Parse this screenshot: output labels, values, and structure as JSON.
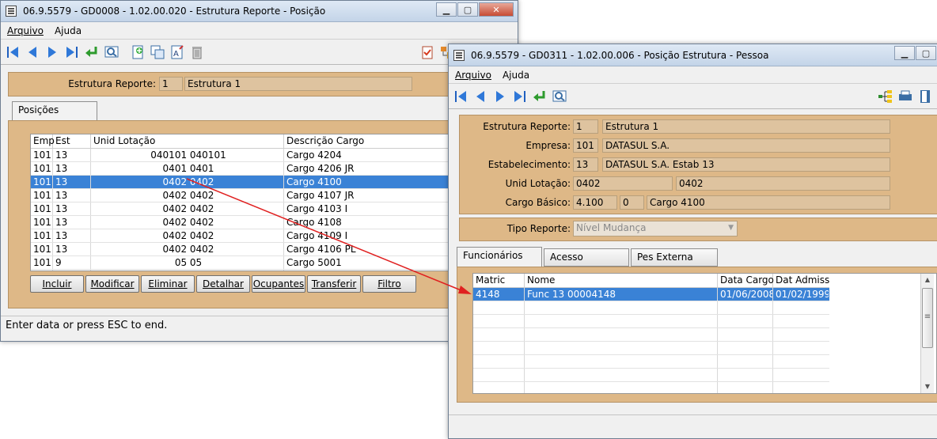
{
  "win1": {
    "title": "06.9.5579 - GD0008 - 1.02.00.020 - Estrutura Reporte - Posição",
    "menu": [
      "Arquivo",
      "Ajuda"
    ],
    "estrutura_label": "Estrutura Reporte:",
    "estrutura_code": "1",
    "estrutura_desc": "Estrutura 1",
    "tab": "Posições",
    "columns": [
      "Emp",
      "Est",
      "Unid Lotação",
      "Descrição Cargo"
    ],
    "rows": [
      [
        "101",
        "13",
        "040101 040101",
        "Cargo 4204"
      ],
      [
        "101",
        "13",
        "0401 0401",
        "Cargo 4206 JR"
      ],
      [
        "101",
        "13",
        "0402 0402",
        "Cargo 4100"
      ],
      [
        "101",
        "13",
        "0402 0402",
        "Cargo 4107 JR"
      ],
      [
        "101",
        "13",
        "0402 0402",
        "Cargo 4103 I"
      ],
      [
        "101",
        "13",
        "0402 0402",
        "Cargo 4108"
      ],
      [
        "101",
        "13",
        "0402 0402",
        "Cargo 4109 I"
      ],
      [
        "101",
        "13",
        "0402 0402",
        "Cargo 4106 PL"
      ],
      [
        "101",
        "9",
        "05 05",
        "Cargo 5001"
      ]
    ],
    "buttons": [
      "Incluir",
      "Modificar",
      "Eliminar",
      "Detalhar",
      "Ocupantes",
      "Transferir",
      "Filtro"
    ],
    "status": "Enter data or press ESC to end."
  },
  "win2": {
    "title": "06.9.5579 - GD0311 - 1.02.00.006 - Posição Estrutura - Pessoa",
    "menu": [
      "Arquivo",
      "Ajuda"
    ],
    "labels": {
      "estrutura": "Estrutura Reporte:",
      "empresa": "Empresa:",
      "estab": "Estabelecimento:",
      "unid": "Unid Lotação:",
      "cargo": "Cargo Básico:",
      "tipo": "Tipo Reporte:"
    },
    "values": {
      "estrutura_code": "1",
      "estrutura_desc": "Estrutura 1",
      "empresa_code": "101",
      "empresa_desc": "DATASUL S.A.",
      "estab_code": "13",
      "estab_desc": "DATASUL S.A. Estab 13",
      "unid_a": "0402",
      "unid_b": "0402",
      "cargo_a": "4.100",
      "cargo_b": "0",
      "cargo_desc": "Cargo 4100",
      "tipo": "Nível Mudança"
    },
    "tabs": [
      "Funcionários",
      "Acesso",
      "Pes Externa"
    ],
    "columns": [
      "Matric",
      "Nome",
      "Data Cargo",
      "Dat Admiss"
    ],
    "rows": [
      [
        "4148",
        "Func 13 00004148",
        "01/06/2008",
        "01/02/1999"
      ]
    ]
  },
  "colors": {
    "tan": "#DEB887",
    "selection": "#3A82D6",
    "arrow": "#E02020"
  }
}
